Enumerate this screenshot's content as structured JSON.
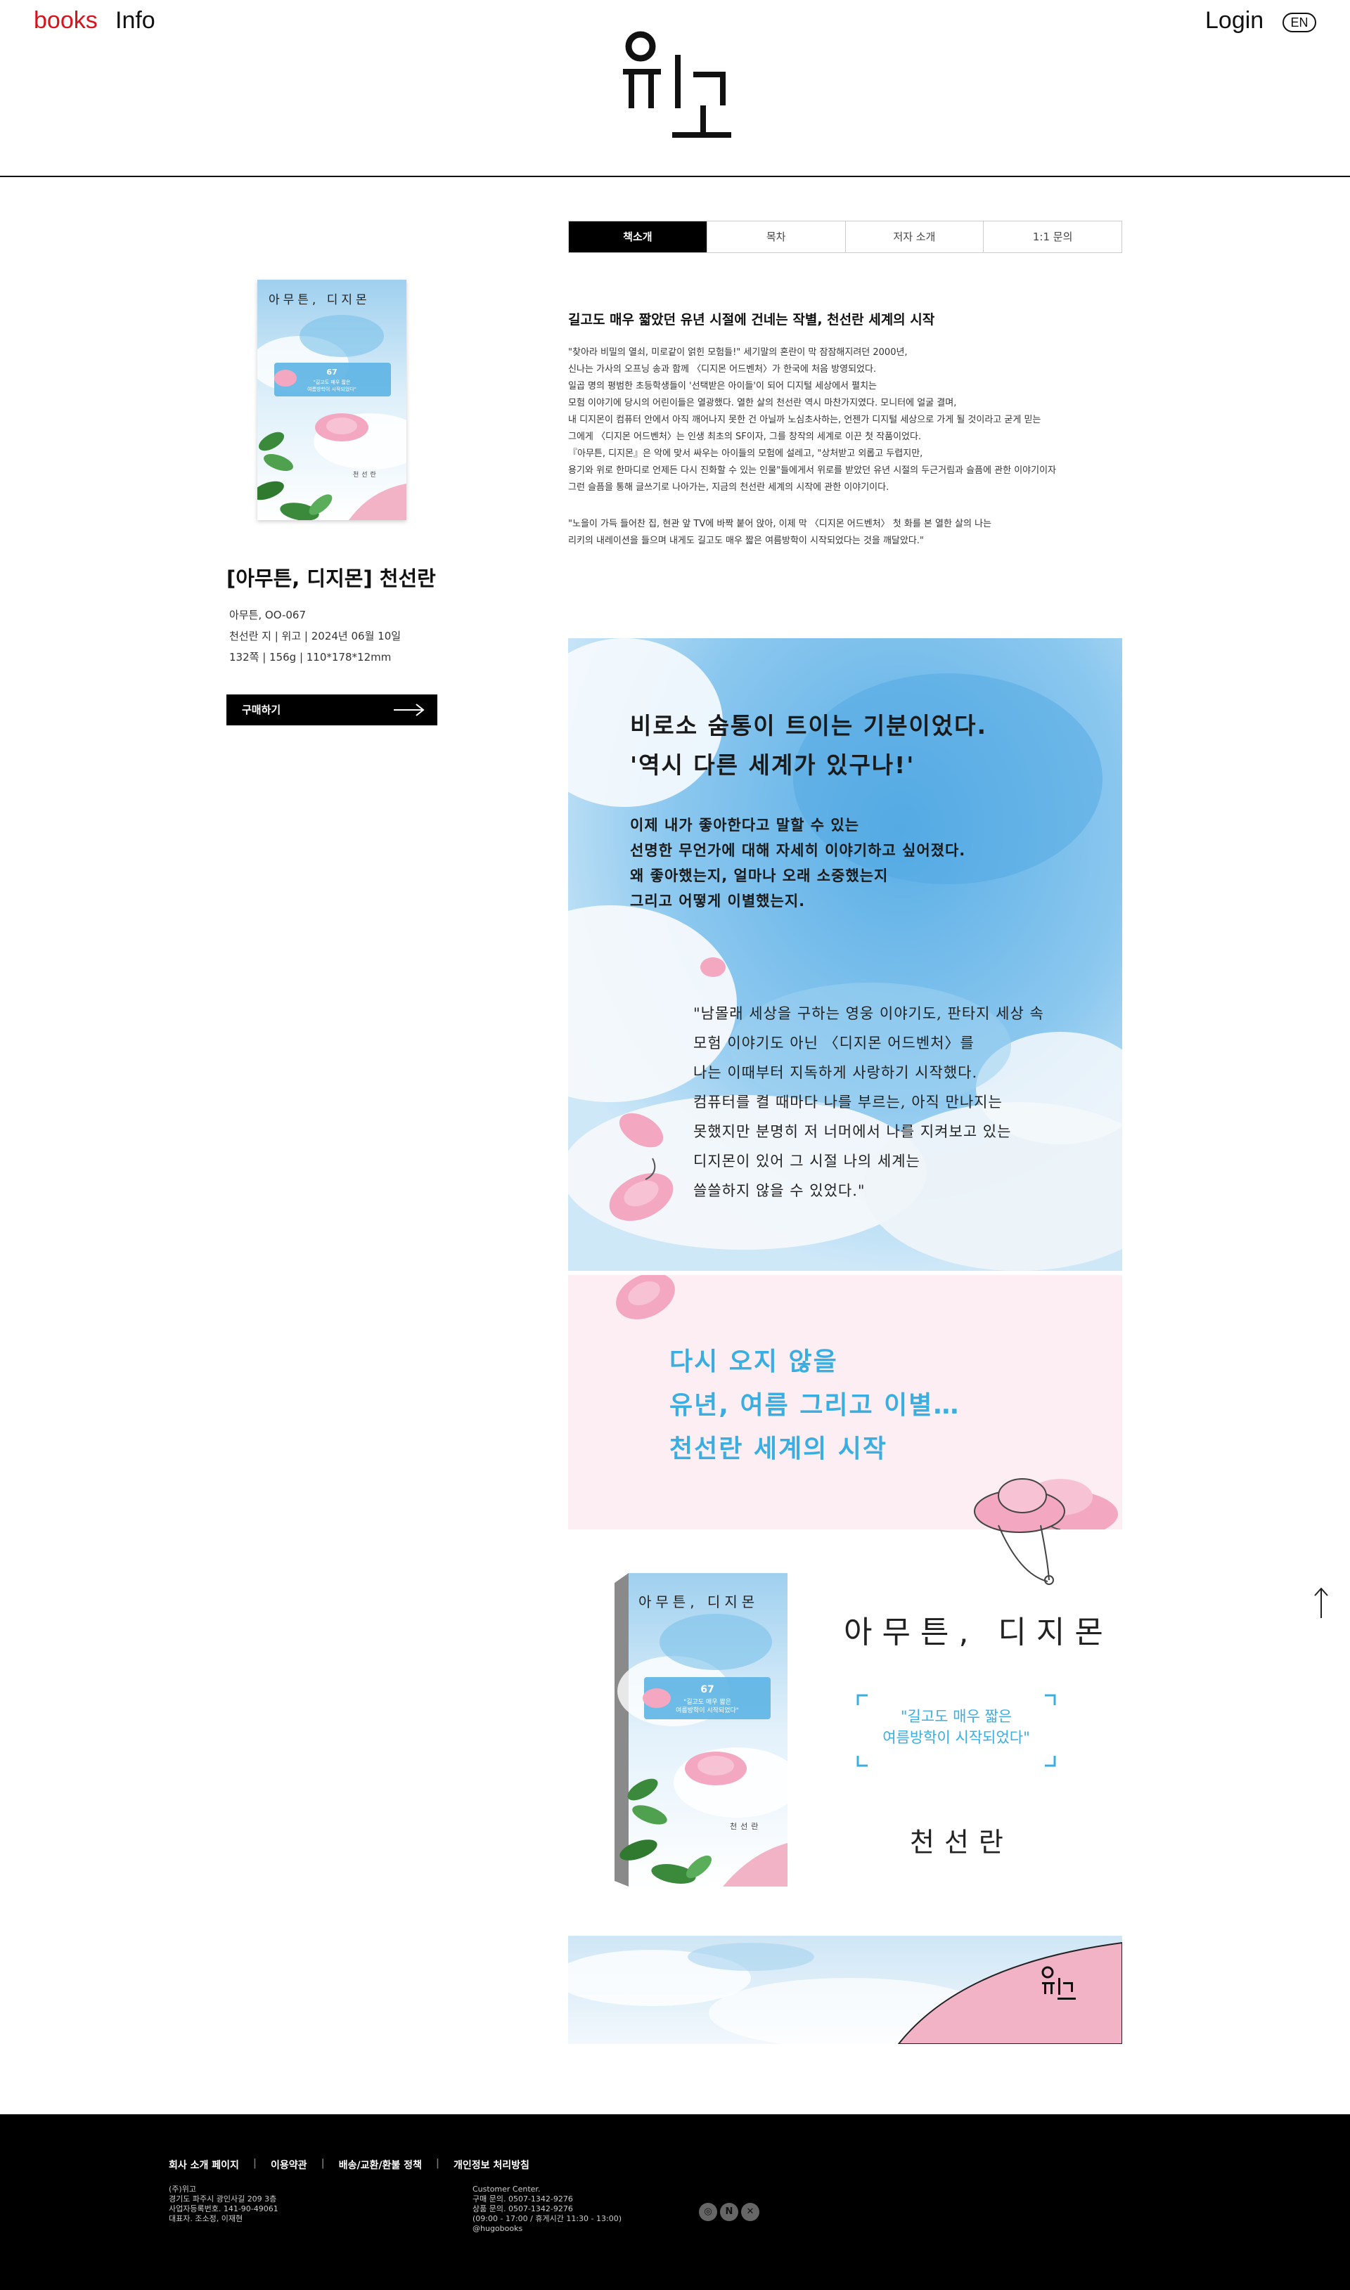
{
  "header": {
    "nav_books": "books",
    "nav_info": "Info",
    "login": "Login",
    "lang": "EN"
  },
  "book": {
    "title": "[아무튼, 디지몬] 천선란",
    "series_no": "아무튼, OO-067",
    "pub_info": "천선란 지 | 위고 | 2024년 06월 10일",
    "spec": "132쪽 | 156g | 110*178*12mm",
    "buy_label": "구매하기",
    "cover_title": "아무튼, 디지몬",
    "cover_number": "67",
    "cover_tagline_1": "\"길고도 매우 짧은",
    "cover_tagline_2": "여름방학이 시작되었다\"",
    "cover_author": "천선란"
  },
  "tabs": [
    "책소개",
    "목차",
    "저자 소개",
    "1:1 문의"
  ],
  "intro": {
    "heading": "길고도 매우 짧았던 유년 시절에 건네는 작별, 천선란 세계의 시작",
    "paragraph_1": [
      "\"찾아라 비밀의 열쇠, 미로같이 얽힌 모험들!\" 세기말의 혼란이 막 잠잠해지려던 2000년,",
      "신나는 가사의 오프닝 송과 함께 〈디지몬 어드벤처〉가 한국에 처음 방영되었다.",
      "일곱 명의 평범한 초등학생들이 '선택받은 아이들'이 되어 디지털 세상에서 펼치는",
      "모험 이야기에 당시의 어린이들은 열광했다. 열한 살의 천선란 역시 마찬가지였다. 모니터에 얼굴 결며,",
      "내 디지몬이 컴퓨터 안에서 아직 깨어나지 못한 건 아닐까 노심초사하는, 언젠가 디지털 세상으로 가게 될 것이라고 굳게 믿는",
      "그에게 〈디지몬 어드벤처〉는 인생 최초의 SF이자, 그를 창작의 세계로 이끈 첫 작품이었다.",
      "『아무튼, 디지몬』은 악에 맞서 싸우는 아이들의 모험에 설레고, \"상처받고 외롭고 두렵지만,",
      "용기와 위로 한마디로 언제든 다시 진화할 수 있는 인물\"들에게서 위로를 받았던 유년 시절의 두근거림과 슬픔에 관한 이야기이자",
      "그런 슬픔을 통해 글쓰기로 나아가는, 지금의 천선란 세계의 시작에 관한 이야기이다."
    ],
    "paragraph_2": [
      "\"노을이 가득 들어찬 집, 현관 앞 TV에 바짝 붙어 앉아, 이제 막 〈디지몬 어드벤처〉 첫 화를 본 열한 살의 나는",
      "리키의 내레이션을 들으며 내게도 길고도 매우 짧은 여름방학이 시작되었다는 것을 깨달았다.\""
    ]
  },
  "banner": {
    "head_1": "비로소 숨통이 트이는 기분이었다.",
    "head_2": "'역시 다른 세계가 있구나!'",
    "mid": [
      "이제 내가 좋아한다고 말할 수 있는",
      "선명한 무언가에 대해 자세히 이야기하고 싶어졌다.",
      "왜 좋아했는지, 얼마나 오래 소중했는지",
      "그리고 어떻게 이별했는지."
    ],
    "quote": [
      "\"남몰래 세상을 구하는 영웅 이야기도, 판타지 세상 속",
      "모험 이야기도 아닌 〈디지몬 어드벤처〉를",
      "나는 이때부터 지독하게 사랑하기 시작했다.",
      "컴퓨터를 켤 때마다 나를 부르는, 아직 만나지는",
      "못했지만 분명히 저 너머에서 나를 지켜보고 있는",
      "디지몬이 있어 그 시절 나의 세계는",
      "쓸쓸하지 않을 수 있었다.\""
    ],
    "blue": [
      "다시 오지 않을",
      "유년, 여름 그리고 이별…",
      "천선란 세계의 시작"
    ]
  },
  "showcase": {
    "title": "아무튼, 디지몬",
    "quote_1": "\"길고도 매우 짧은",
    "quote_2": "여름방학이 시작되었다\"",
    "author": "천선란"
  },
  "footer": {
    "links": [
      "회사 소개 페이지",
      "이용약관",
      "배송/교환/환불 정책",
      "개인정보 처리방침"
    ],
    "company": [
      "(주)위고",
      "경기도 파주시 광인사길 209 3층",
      "사업자등록번호. 141-90-49061",
      "대표자. 조소정, 이재현"
    ],
    "service": [
      "Customer Center.",
      "구매 문의. 0507-1342-9276",
      "상품 문의. 0507-1342-9276",
      "(09:00 - 17:00 / 휴게시간 11:30 - 13:00)",
      "@hugobooks"
    ],
    "social_icons": [
      "instagram-icon",
      "naver-icon",
      "x-icon"
    ]
  },
  "colors": {
    "accent_red": "#d8131c",
    "sky_blue": "#3aaee0",
    "pink": "#f3b3c7",
    "footer_bg": "#000000"
  }
}
